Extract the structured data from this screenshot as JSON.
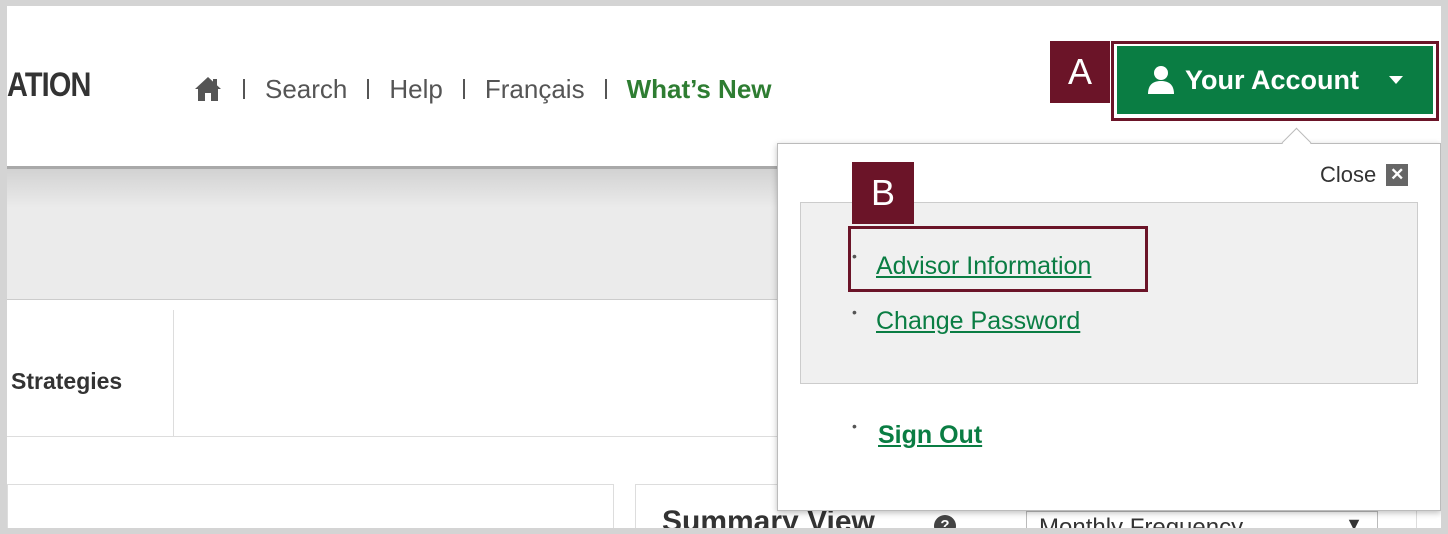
{
  "header": {
    "logo_text": "ATION",
    "nav": {
      "search": "Search",
      "help": "Help",
      "language": "Français",
      "whats_new": "What’s New"
    },
    "account_button": "Your Account"
  },
  "annotations": {
    "a": "A",
    "b": "B"
  },
  "dropdown": {
    "close_label": "Close",
    "close_symbol": "✕",
    "items": [
      "Advisor Information",
      "Change Password"
    ],
    "sign_out": "Sign Out"
  },
  "tabs": {
    "strategies": "Strategies"
  },
  "summary": {
    "title": "Summary View",
    "help_symbol": "?",
    "frequency_value": "Monthly Frequency",
    "frequency_arrow": "▼"
  },
  "colors": {
    "brand_green": "#0a7d43",
    "annotation_maroon": "#6b1428",
    "whats_new_green": "#2e7d32"
  }
}
